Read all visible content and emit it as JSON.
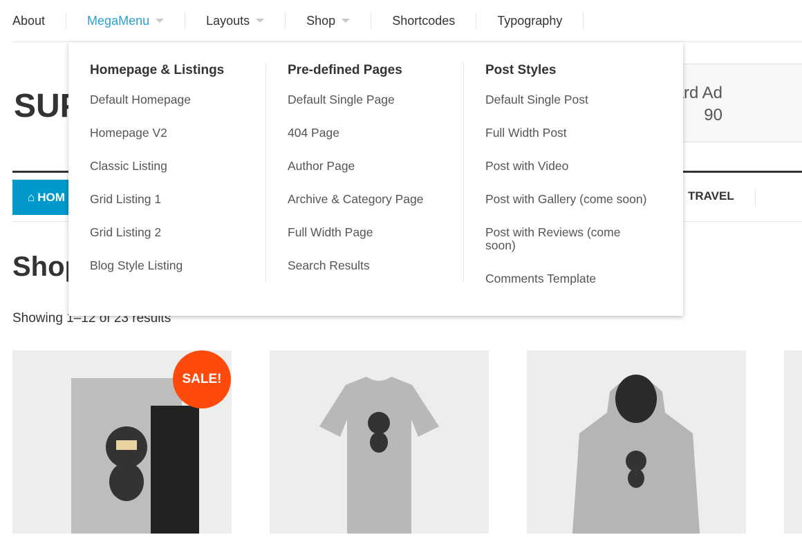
{
  "topnav": {
    "items": [
      {
        "label": "About",
        "caret": false
      },
      {
        "label": "MegaMenu",
        "caret": true,
        "active": true
      },
      {
        "label": "Layouts",
        "caret": true
      },
      {
        "label": "Shop",
        "caret": true
      },
      {
        "label": "Shortcodes",
        "caret": false
      },
      {
        "label": "Typography",
        "caret": false
      }
    ]
  },
  "header": {
    "logo_partial": "SUP",
    "ad_line1": "ard Ad",
    "ad_line2": "90"
  },
  "mainnav": {
    "home": "HOM",
    "travel": "TRAVEL",
    "home_color": "#0099cc"
  },
  "shop": {
    "title": "Shop",
    "result_count": "Showing 1–12 of 23 results",
    "sale_badge": "SALE!",
    "sale_color": "#ff4a0d"
  },
  "megamenu": {
    "columns": [
      {
        "title": "Homepage & Listings",
        "links": [
          "Default Homepage",
          "Homepage V2",
          "Classic Listing",
          "Grid Listing 1",
          "Grid Listing 2",
          "Blog Style Listing"
        ]
      },
      {
        "title": "Pre-defined Pages",
        "links": [
          "Default Single Page",
          "404 Page",
          "Author Page",
          "Archive & Category Page",
          "Full Width Page",
          "Search Results"
        ]
      },
      {
        "title": "Post Styles",
        "links": [
          "Default Single Post",
          "Full Width Post",
          "Post with Video",
          "Post with Gallery (come soon)",
          "Post with Reviews (come soon)",
          "Comments Template"
        ]
      }
    ]
  }
}
